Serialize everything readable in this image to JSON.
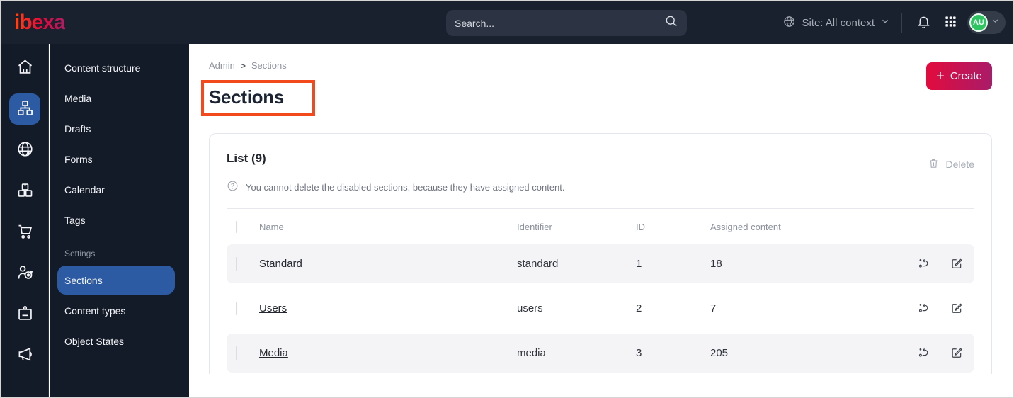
{
  "topbar": {
    "logo": "ibexa",
    "search_placeholder": "Search...",
    "site_selector": "Site: All context",
    "avatar_initials": "AU",
    "icons": [
      "globe-icon",
      "chevron-down-icon",
      "bell-icon",
      "app-grid-icon"
    ]
  },
  "sidebar": {
    "rail_icons": [
      "home-icon",
      "content-structure-icon",
      "site-icon",
      "product-catalog-icon",
      "commerce-icon",
      "customer-icon",
      "corporate-icon",
      "marketing-icon"
    ],
    "menu": {
      "items": [
        "Content structure",
        "Media",
        "Drafts",
        "Forms",
        "Calendar",
        "Tags"
      ],
      "settings_header": "Settings",
      "settings_items": [
        "Sections",
        "Content types",
        "Object States"
      ],
      "active_item": "Sections"
    }
  },
  "main": {
    "breadcrumb": {
      "items": [
        "Admin",
        "Sections"
      ],
      "separator": ">"
    },
    "create_label": "Create",
    "page_title": "Sections",
    "list": {
      "title": "List (9)",
      "help_text": "You cannot delete the disabled sections, because they have assigned content.",
      "delete_label": "Delete",
      "table": {
        "columns": [
          "Name",
          "Identifier",
          "ID",
          "Assigned content"
        ],
        "rows": [
          {
            "name": "Standard",
            "identifier": "standard",
            "id": "1",
            "assigned": "18"
          },
          {
            "name": "Users",
            "identifier": "users",
            "id": "2",
            "assigned": "7"
          },
          {
            "name": "Media",
            "identifier": "media",
            "id": "3",
            "assigned": "205"
          }
        ]
      }
    }
  },
  "colors": {
    "topbar_bg": "#19202e",
    "sidebar_bg": "#141b28",
    "active_blue": "#2c5ba4",
    "brand_gradient_start": "#e30b3d",
    "brand_gradient_end": "#a81c69",
    "highlight_orange": "#f24a1c",
    "stripe_row": "#f4f4f6",
    "avatar_green": "#2ec462"
  }
}
